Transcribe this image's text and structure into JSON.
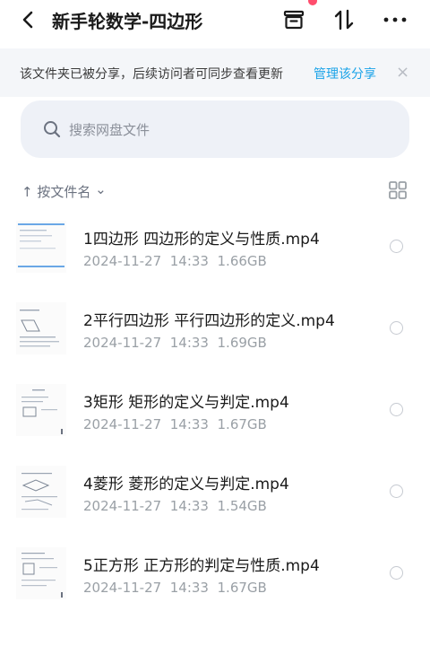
{
  "header": {
    "title": "新手轮数学-四边形"
  },
  "notice": {
    "text": "该文件夹已被分享，后续访问者可同步查看更新",
    "link": "管理该分享",
    "close": "×"
  },
  "search": {
    "placeholder": "搜索网盘文件"
  },
  "sort": {
    "arrow": "↑",
    "label": "按文件名",
    "chevron": "⌄"
  },
  "files": [
    {
      "name": "1四边形 四边形的定义与性质.mp4",
      "date": "2024-11-27",
      "time": "14:33",
      "size": "1.66GB"
    },
    {
      "name": "2平行四边形 平行四边形的定义.mp4",
      "date": "2024-11-27",
      "time": "14:33",
      "size": "1.69GB"
    },
    {
      "name": "3矩形 矩形的定义与判定.mp4",
      "date": "2024-11-27",
      "time": "14:33",
      "size": "1.67GB"
    },
    {
      "name": "4菱形 菱形的定义与判定.mp4",
      "date": "2024-11-27",
      "time": "14:33",
      "size": "1.54GB"
    },
    {
      "name": "5正方形 正方形的判定与性质.mp4",
      "date": "2024-11-27",
      "time": "14:33",
      "size": "1.67GB"
    }
  ]
}
